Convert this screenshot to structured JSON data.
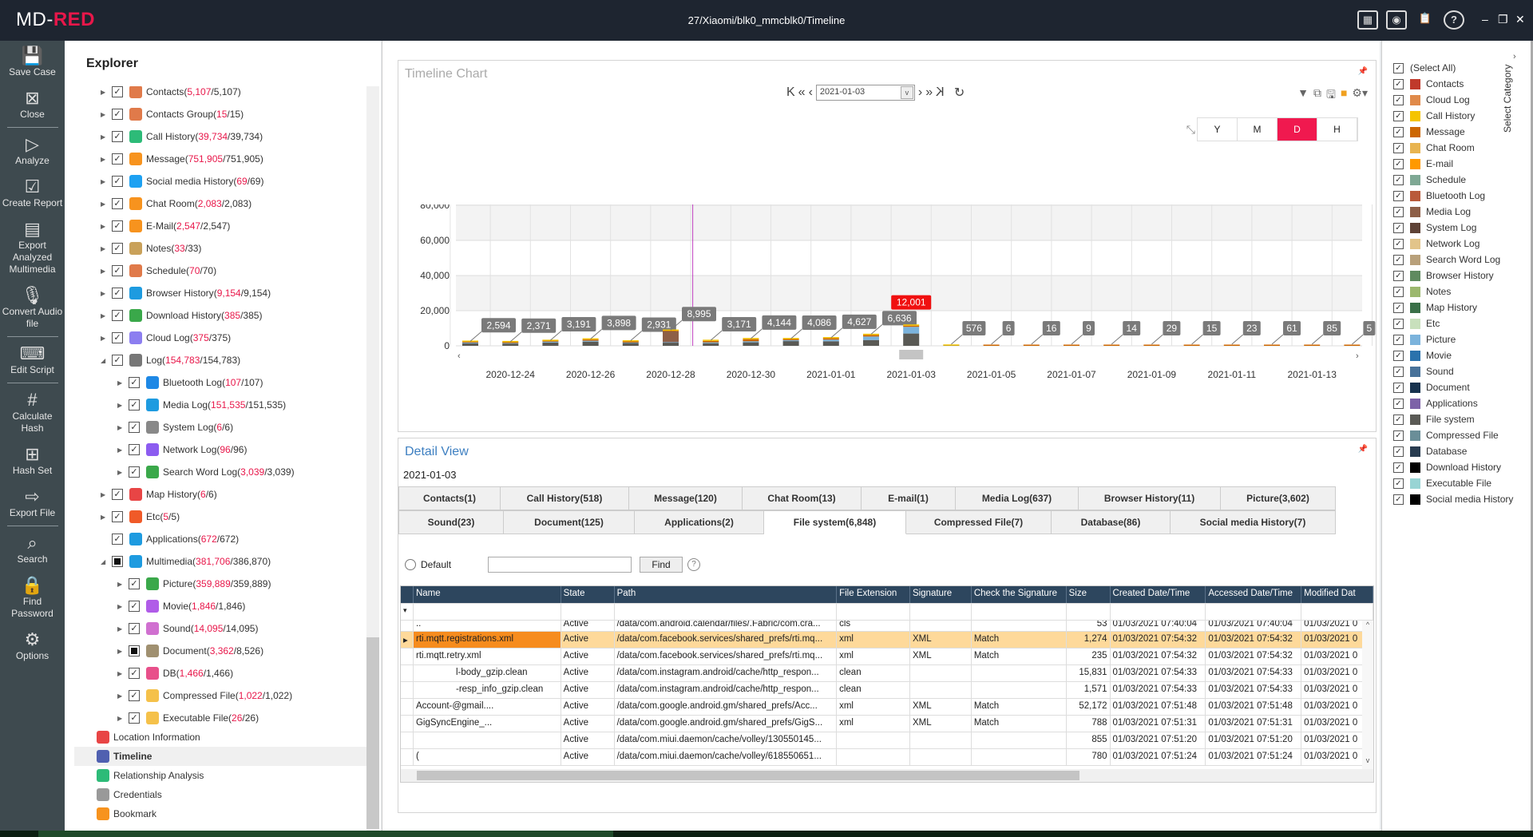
{
  "app": {
    "logo_prefix": "MD-",
    "logo_accent": "RED",
    "title": "27/Xiaomi/blk0_mmcblk0/Timeline",
    "accent": "#e8174a",
    "title_icons": [
      "monitor-icon",
      "camera-icon",
      "clipboard-icon",
      "help-icon"
    ],
    "help_label": "?",
    "minimize": "–",
    "restore": "❐",
    "close": "✕"
  },
  "toolbar": [
    {
      "label": "Save Case",
      "icon": "save-icon",
      "glyph": "💾"
    },
    {
      "label": "Close",
      "icon": "close-case-icon",
      "glyph": "⊠"
    },
    {
      "divider": true
    },
    {
      "label": "Analyze",
      "icon": "analyze-icon",
      "glyph": "▷"
    },
    {
      "label": "Create Report",
      "icon": "report-icon",
      "glyph": "☑"
    },
    {
      "label": "Export Analyzed Multimedia",
      "icon": "export-multimedia-icon",
      "glyph": "▤"
    },
    {
      "label": "Convert Audio file",
      "icon": "microphone-icon",
      "glyph": "🎙"
    },
    {
      "divider": true
    },
    {
      "label": "Edit Script",
      "icon": "script-icon",
      "glyph": "⌨"
    },
    {
      "divider": true
    },
    {
      "label": "Calculate Hash",
      "icon": "hash-icon",
      "glyph": "#"
    },
    {
      "label": "Hash Set",
      "icon": "hash-set-icon",
      "glyph": "⊞"
    },
    {
      "label": "Export File",
      "icon": "export-file-icon",
      "glyph": "⇨"
    },
    {
      "divider": true
    },
    {
      "label": "Search",
      "icon": "search-icon",
      "glyph": "⌕"
    },
    {
      "label": "Find Password",
      "icon": "lock-icon",
      "glyph": "🔒"
    },
    {
      "label": "Options",
      "icon": "gear-icon",
      "glyph": "⚙"
    }
  ],
  "explorer": {
    "title": "Explorer",
    "tree": [
      {
        "label": "Contacts",
        "count": "5,107",
        "total": "5,107",
        "level": 0,
        "exp": "collapsed",
        "check": "checked",
        "icon": "contacts-icon",
        "color": "#e07a4a"
      },
      {
        "label": "Contacts Group",
        "count": "15",
        "total": "15",
        "level": 0,
        "exp": "collapsed",
        "check": "checked",
        "icon": "contacts-group-icon",
        "color": "#e07a4a"
      },
      {
        "label": "Call History",
        "count": "39,734",
        "total": "39,734",
        "level": 0,
        "exp": "collapsed",
        "check": "checked",
        "icon": "phone-icon",
        "color": "#2dbb78"
      },
      {
        "label": "Message",
        "count": "751,905",
        "total": "751,905",
        "level": 0,
        "exp": "collapsed",
        "check": "checked",
        "icon": "message-icon",
        "color": "#f7931e"
      },
      {
        "label": "Social media History",
        "count": "69",
        "total": "69",
        "level": 0,
        "exp": "collapsed",
        "check": "checked",
        "icon": "social-media-icon",
        "color": "#1da1f2"
      },
      {
        "label": "Chat Room",
        "count": "2,083",
        "total": "2,083",
        "level": 0,
        "exp": "collapsed",
        "check": "checked",
        "icon": "chat-icon",
        "color": "#f7931e"
      },
      {
        "label": "E-Mail",
        "count": "2,547",
        "total": "2,547",
        "level": 0,
        "exp": "collapsed",
        "check": "checked",
        "icon": "mail-icon",
        "color": "#f7931e"
      },
      {
        "label": "Notes",
        "count": "33",
        "total": "33",
        "level": 0,
        "exp": "collapsed",
        "check": "checked",
        "icon": "notes-icon",
        "color": "#c9a15a"
      },
      {
        "label": "Schedule",
        "count": "70",
        "total": "70",
        "level": 0,
        "exp": "collapsed",
        "check": "checked",
        "icon": "calendar-icon",
        "color": "#e07a4a"
      },
      {
        "label": "Browser History",
        "count": "9,154",
        "total": "9,154",
        "level": 0,
        "exp": "collapsed",
        "check": "checked",
        "icon": "globe-icon",
        "color": "#1e9be0"
      },
      {
        "label": "Download History",
        "count": "385",
        "total": "385",
        "level": 0,
        "exp": "collapsed",
        "check": "checked",
        "icon": "download-icon",
        "color": "#3aa84a"
      },
      {
        "label": "Cloud Log",
        "count": "375",
        "total": "375",
        "level": 0,
        "exp": "collapsed",
        "check": "checked",
        "icon": "cloud-icon",
        "color": "#8c7ef0"
      },
      {
        "label": "Log",
        "count": "154,783",
        "total": "154,783",
        "level": 0,
        "exp": "expanded",
        "check": "checked",
        "icon": "log-icon",
        "color": "#777"
      },
      {
        "label": "Bluetooth Log",
        "count": "107",
        "total": "107",
        "level": 1,
        "exp": "collapsed",
        "check": "checked",
        "icon": "bluetooth-icon",
        "color": "#1e88e5"
      },
      {
        "label": "Media Log",
        "count": "151,535",
        "total": "151,535",
        "level": 1,
        "exp": "collapsed",
        "check": "checked",
        "icon": "media-log-icon",
        "color": "#1e9be0"
      },
      {
        "label": "System Log",
        "count": "6",
        "total": "6",
        "level": 1,
        "exp": "collapsed",
        "check": "checked",
        "icon": "system-log-icon",
        "color": "#888"
      },
      {
        "label": "Network Log",
        "count": "96",
        "total": "96",
        "level": 1,
        "exp": "collapsed",
        "check": "checked",
        "icon": "wifi-icon",
        "color": "#8c5cf0"
      },
      {
        "label": "Search Word Log",
        "count": "3,039",
        "total": "3,039",
        "level": 1,
        "exp": "collapsed",
        "check": "checked",
        "icon": "search-word-icon",
        "color": "#3aa84a"
      },
      {
        "label": "Map History",
        "count": "6",
        "total": "6",
        "level": 0,
        "exp": "collapsed",
        "check": "checked",
        "icon": "map-pin-icon",
        "color": "#e84545"
      },
      {
        "label": "Etc",
        "count": "5",
        "total": "5",
        "level": 0,
        "exp": "collapsed",
        "check": "checked",
        "icon": "info-icon",
        "color": "#f05a28"
      },
      {
        "label": "Applications",
        "count": "672",
        "total": "672",
        "level": 0,
        "exp": "none",
        "check": "checked",
        "icon": "app-store-icon",
        "color": "#1e9be0"
      },
      {
        "label": "Multimedia",
        "count": "381,706",
        "total": "386,870",
        "level": 0,
        "exp": "expanded",
        "check": "partial",
        "icon": "multimedia-icon",
        "color": "#1e9be0"
      },
      {
        "label": "Picture",
        "count": "359,889",
        "total": "359,889",
        "level": 1,
        "exp": "collapsed",
        "check": "checked",
        "icon": "picture-icon",
        "color": "#3aa84a"
      },
      {
        "label": "Movie",
        "count": "1,846",
        "total": "1,846",
        "level": 1,
        "exp": "collapsed",
        "check": "checked",
        "icon": "movie-icon",
        "color": "#b05ce8"
      },
      {
        "label": "Sound",
        "count": "14,095",
        "total": "14,095",
        "level": 1,
        "exp": "collapsed",
        "check": "checked",
        "icon": "sound-icon",
        "color": "#d070d0"
      },
      {
        "label": "Document",
        "count": "3,362",
        "total": "8,526",
        "level": 1,
        "exp": "collapsed",
        "check": "partial",
        "icon": "document-icon",
        "color": "#a09070"
      },
      {
        "label": "DB",
        "count": "1,466",
        "total": "1,466",
        "level": 1,
        "exp": "collapsed",
        "check": "checked",
        "icon": "database-icon",
        "color": "#e8508a"
      },
      {
        "label": "Compressed File",
        "count": "1,022",
        "total": "1,022",
        "level": 1,
        "exp": "collapsed",
        "check": "checked",
        "icon": "folder-icon",
        "color": "#f5c14a"
      },
      {
        "label": "Executable File",
        "count": "26",
        "total": "26",
        "level": 1,
        "exp": "collapsed",
        "check": "checked",
        "icon": "folder-icon",
        "color": "#f5c14a"
      }
    ],
    "extras": [
      {
        "label": "Location Information",
        "icon": "location-icon",
        "color": "#e84545"
      },
      {
        "label": "Timeline",
        "icon": "timeline-icon",
        "color": "#5060b0",
        "selected": true
      },
      {
        "label": "Relationship Analysis",
        "icon": "relationship-icon",
        "color": "#2dbb78"
      },
      {
        "label": "Credentials",
        "icon": "credentials-icon",
        "color": "#999"
      },
      {
        "label": "Bookmark",
        "icon": "star-icon",
        "color": "#f7931e"
      }
    ]
  },
  "timeline": {
    "title": "Timeline Chart",
    "nav": {
      "first": "K",
      "prev_fast": "«",
      "prev": "‹",
      "date": "2021-01-03",
      "next": "›",
      "next_fast": "»",
      "last": "K",
      "refresh": "↻"
    },
    "scales": [
      "Y",
      "M",
      "D",
      "H"
    ],
    "active_scale": "D",
    "highlight_color": "#f0194f"
  },
  "chart_data": {
    "type": "bar",
    "stacked": true,
    "categories": [
      "2020-12-23",
      "2020-12-24",
      "2020-12-25",
      "2020-12-26",
      "2020-12-27",
      "2020-12-28",
      "2020-12-29",
      "2020-12-30",
      "2020-12-31",
      "2021-01-01",
      "2021-01-02",
      "2021-01-03",
      "2021-01-04",
      "2021-01-05",
      "2021-01-06",
      "2021-01-07",
      "2021-01-08",
      "2021-01-09",
      "2021-01-10",
      "2021-01-11",
      "2021-01-12",
      "2021-01-13",
      "2021-01-14"
    ],
    "series": [
      {
        "name": "File system",
        "color": "#5a5a55",
        "values": [
          1500,
          1300,
          1900,
          2400,
          1600,
          1800,
          1500,
          2000,
          2700,
          2600,
          3300,
          7000,
          100,
          0,
          0,
          0,
          0,
          0,
          0,
          0,
          0,
          0,
          0
        ]
      },
      {
        "name": "Picture",
        "color": "#7bb3dc",
        "values": [
          400,
          300,
          500,
          500,
          300,
          300,
          500,
          600,
          500,
          900,
          2000,
          3800,
          0,
          0,
          0,
          0,
          0,
          0,
          0,
          0,
          0,
          0,
          0
        ]
      },
      {
        "name": "Media Log",
        "color": "#8e5f47",
        "values": [
          0,
          0,
          0,
          0,
          0,
          6200,
          0,
          0,
          0,
          0,
          0,
          0,
          0,
          0,
          0,
          0,
          0,
          0,
          0,
          0,
          0,
          0,
          0
        ]
      },
      {
        "name": "Message",
        "color": "#cc6600",
        "values": [
          400,
          500,
          400,
          700,
          600,
          300,
          800,
          1200,
          600,
          800,
          900,
          700,
          0,
          6,
          16,
          9,
          14,
          29,
          15,
          23,
          61,
          85,
          5
        ]
      },
      {
        "name": "Call History",
        "color": "#f5c400",
        "values": [
          294,
          271,
          391,
          298,
          431,
          395,
          371,
          344,
          286,
          327,
          436,
          501,
          476,
          0,
          0,
          0,
          0,
          0,
          0,
          0,
          0,
          0,
          0
        ]
      }
    ],
    "totals": [
      "2,594",
      "2,371",
      "3,191",
      "3,898",
      "2,931",
      "8,995",
      "3,171",
      "4,144",
      "4,086",
      "4,627",
      "6,636",
      "12,001",
      "576",
      "6",
      "16",
      "9",
      "14",
      "29",
      "15",
      "23",
      "61",
      "85",
      "5"
    ],
    "selected": "2021-01-03",
    "yticks": [
      "0",
      "20,000",
      "40,000",
      "60,000",
      "80,000"
    ],
    "ylim": [
      0,
      80000
    ],
    "xticks": [
      "2020-12-24",
      "2020-12-26",
      "2020-12-28",
      "2020-12-30",
      "2021-01-01",
      "2021-01-03",
      "2021-01-05",
      "2021-01-07",
      "2021-01-09",
      "2021-01-11",
      "2021-01-13"
    ],
    "grid": true
  },
  "detail": {
    "title": "Detail View",
    "date": "2021-01-03",
    "tabs_row1": [
      "Contacts(1)",
      "Call History(518)",
      "Message(120)",
      "Chat Room(13)",
      "E-mail(1)",
      "Media Log(637)",
      "Browser History(11)",
      "Picture(3,602)"
    ],
    "tabs_row2": [
      "Sound(23)",
      "Document(125)",
      "Applications(2)",
      "File system(6,848)",
      "Compressed File(7)",
      "Database(86)",
      "Social media History(7)"
    ],
    "active_tab": "File system(6,848)",
    "filter": {
      "default_label": "Default",
      "input_value": "",
      "find_label": "Find",
      "help": "?"
    },
    "columns": [
      "Name",
      "State",
      "Path",
      "File Extension",
      "Signature",
      "Check the Signature",
      "Size",
      "Created Date/Time",
      "Accessed Date/Time",
      "Modified Dat"
    ],
    "rows": [
      {
        "name": "..",
        "state": "Active",
        "path": "/data/com.android.calendar/files/.Fabric/com.cra...",
        "ext": "cls",
        "sig": "",
        "check": "",
        "size": "53",
        "created": "01/03/2021 07:40:04",
        "accessed": "01/03/2021 07:40:04",
        "modified": "01/03/2021 0"
      },
      {
        "name": "rti.mqtt.registrations.xml",
        "state": "Active",
        "path": "/data/com.facebook.services/shared_prefs/rti.mq...",
        "ext": "xml",
        "sig": "XML",
        "check": "Match",
        "size": "1,274",
        "created": "01/03/2021 07:54:32",
        "accessed": "01/03/2021 07:54:32",
        "modified": "01/03/2021 0",
        "selected": true
      },
      {
        "name": "rti.mqtt.retry.xml",
        "state": "Active",
        "path": "/data/com.facebook.services/shared_prefs/rti.mq...",
        "ext": "xml",
        "sig": "XML",
        "check": "Match",
        "size": "235",
        "created": "01/03/2021 07:54:32",
        "accessed": "01/03/2021 07:54:32",
        "modified": "01/03/2021 0"
      },
      {
        "name": "l-body_gzip.clean",
        "state": "Active",
        "path": "/data/com.instagram.android/cache/http_respon...",
        "ext": "clean",
        "sig": "",
        "check": "",
        "size": "15,831",
        "created": "01/03/2021 07:54:33",
        "accessed": "01/03/2021 07:54:33",
        "modified": "01/03/2021 0",
        "redact_before": 50
      },
      {
        "name": "-resp_info_gzip.clean",
        "state": "Active",
        "path": "/data/com.instagram.android/cache/http_respon...",
        "ext": "clean",
        "sig": "",
        "check": "",
        "size": "1,571",
        "created": "01/03/2021 07:54:33",
        "accessed": "01/03/2021 07:54:33",
        "modified": "01/03/2021 0",
        "redact_before": 50
      },
      {
        "name": "Account-@gmail....",
        "state": "Active",
        "path": "/data/com.google.android.gm/shared_prefs/Acc...",
        "ext": "xml",
        "sig": "XML",
        "check": "Match",
        "size": "52,172",
        "created": "01/03/2021 07:51:48",
        "accessed": "01/03/2021 07:51:48",
        "modified": "01/03/2021 0"
      },
      {
        "name": "GigSyncEngine_...",
        "state": "Active",
        "path": "/data/com.google.android.gm/shared_prefs/GigS...",
        "ext": "xml",
        "sig": "XML",
        "check": "Match",
        "size": "788",
        "created": "01/03/2021 07:51:31",
        "accessed": "01/03/2021 07:51:31",
        "modified": "01/03/2021 0"
      },
      {
        "name": "",
        "state": "Active",
        "path": "/data/com.miui.daemon/cache/volley/130550145...",
        "ext": "",
        "sig": "",
        "check": "",
        "size": "855",
        "created": "01/03/2021 07:51:20",
        "accessed": "01/03/2021 07:51:20",
        "modified": "01/03/2021 0"
      },
      {
        "name": "(",
        "state": "Active",
        "path": "/data/com.miui.daemon/cache/volley/618550651...",
        "ext": "",
        "sig": "",
        "check": "",
        "size": "780",
        "created": "01/03/2021 07:51:24",
        "accessed": "01/03/2021 07:51:24",
        "modified": "01/03/2021 0"
      }
    ]
  },
  "categories": {
    "title": "Select Category",
    "select_all": "(Select All)",
    "items": [
      {
        "label": "Contacts",
        "color": "#c0392b"
      },
      {
        "label": "Cloud Log",
        "color": "#e08a4a"
      },
      {
        "label": "Call History",
        "color": "#f5c400"
      },
      {
        "label": "Message",
        "color": "#cc6600"
      },
      {
        "label": "Chat Room",
        "color": "#e8b450"
      },
      {
        "label": "E-mail",
        "color": "#ff9900"
      },
      {
        "label": "Schedule",
        "color": "#7fa894"
      },
      {
        "label": "Bluetooth Log",
        "color": "#b95a3a"
      },
      {
        "label": "Media Log",
        "color": "#8e5f47"
      },
      {
        "label": "System Log",
        "color": "#5e4236"
      },
      {
        "label": "Network Log",
        "color": "#e2c48a"
      },
      {
        "label": "Search Word Log",
        "color": "#b8a07a"
      },
      {
        "label": "Browser History",
        "color": "#5f8a5f"
      },
      {
        "label": "Notes",
        "color": "#9cb86e"
      },
      {
        "label": "Map History",
        "color": "#3a7048"
      },
      {
        "label": "Etc",
        "color": "#c8e0bc"
      },
      {
        "label": "Picture",
        "color": "#7bb3dc"
      },
      {
        "label": "Movie",
        "color": "#2a72ac"
      },
      {
        "label": "Sound",
        "color": "#48729a"
      },
      {
        "label": "Document",
        "color": "#16324e"
      },
      {
        "label": "Applications",
        "color": "#7d62a8"
      },
      {
        "label": "File system",
        "color": "#5a5a55"
      },
      {
        "label": "Compressed File",
        "color": "#6a8e98"
      },
      {
        "label": "Database",
        "color": "#283c50"
      },
      {
        "label": "Download History",
        "color": "#000000"
      },
      {
        "label": "Executable File",
        "color": "#98d4d4"
      },
      {
        "label": "Social media History",
        "color": "#000000"
      }
    ]
  }
}
